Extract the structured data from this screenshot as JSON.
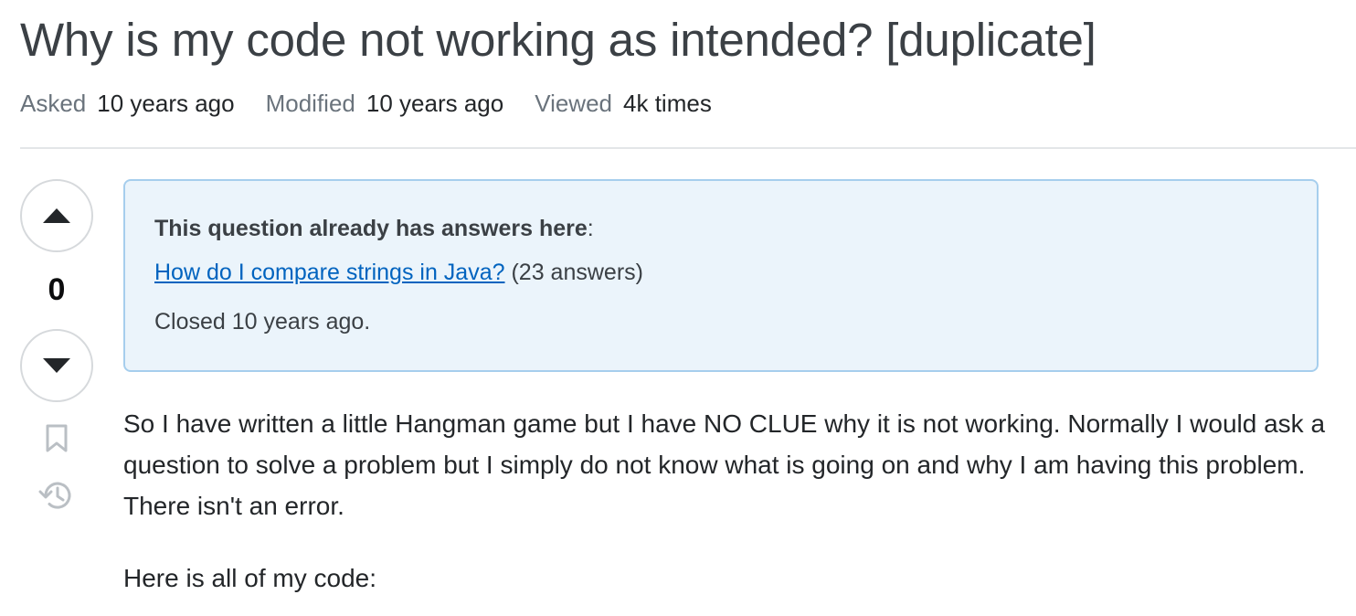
{
  "question": {
    "title": "Why is my code not working as intended? [duplicate]"
  },
  "meta": {
    "asked_label": "Asked",
    "asked_value": "10 years ago",
    "modified_label": "Modified",
    "modified_value": "10 years ago",
    "viewed_label": "Viewed",
    "viewed_value": "4k times"
  },
  "vote": {
    "score": "0",
    "up_icon": "triangle-up-icon",
    "down_icon": "triangle-down-icon",
    "bookmark_icon": "bookmark-icon",
    "history_icon": "history-icon"
  },
  "notice": {
    "heading": "This question already has answers here",
    "heading_suffix": ":",
    "link_text": "How do I compare strings in Java?",
    "answers_count": "(23 answers)",
    "closed_text": "Closed 10 years ago."
  },
  "body": {
    "paragraph_1": "So I have written a little Hangman game but I have NO CLUE why it is not working. Normally I would ask a question to solve a problem but I simply do not know what is going on and why I am having this problem. There isn't an error.",
    "paragraph_2": "Here is all of my code:"
  },
  "colors": {
    "link": "#0063bf",
    "notice_bg": "#ebf4fb",
    "notice_border": "#a6ceed",
    "muted_text": "#6a737c"
  }
}
